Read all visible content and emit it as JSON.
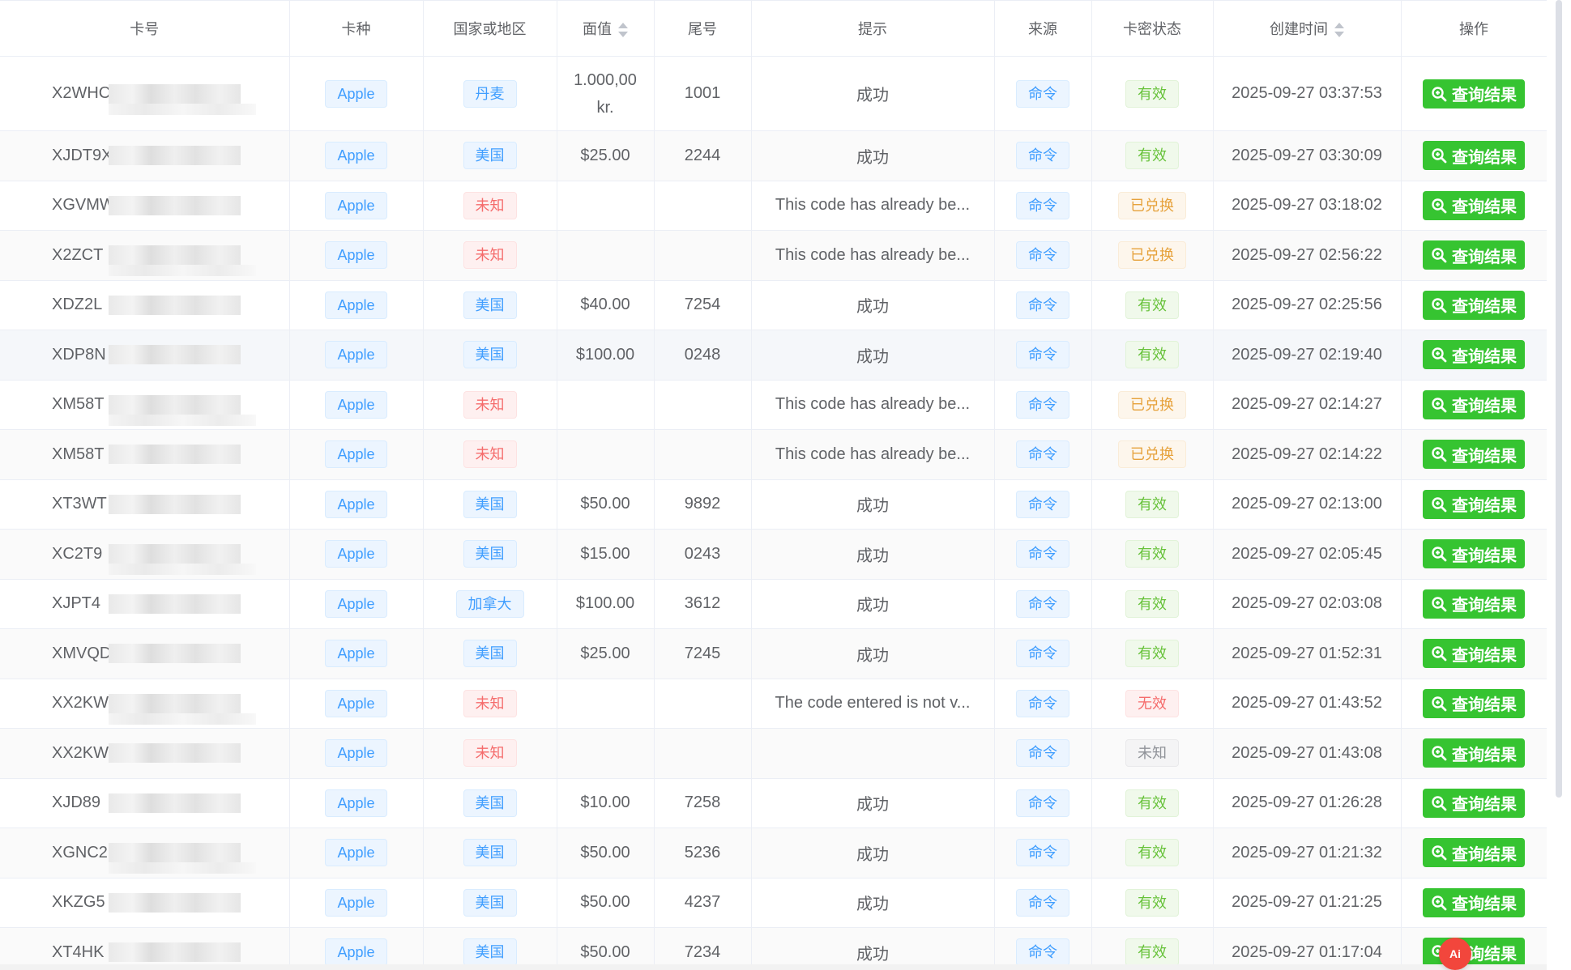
{
  "headers": {
    "card_no": "卡号",
    "card_type": "卡种",
    "country": "国家或地区",
    "value": "面值",
    "tail": "尾号",
    "hint": "提示",
    "source": "来源",
    "status": "卡密状态",
    "created": "创建时间",
    "action": "操作"
  },
  "action_label": "查询结果",
  "colors": {
    "action_button": "#36c431",
    "tag_blue": "#409eff",
    "tag_red": "#f56c6c",
    "tag_green": "#67c23a",
    "tag_orange": "#e6a23c",
    "tag_gray": "#909399"
  },
  "icons": {
    "action": "search-zoom-icon",
    "sort": "sort-caret-icon",
    "ai": "ai-assistant-icon"
  },
  "ai_badge": "Ai",
  "rows": [
    {
      "card": "X2WHC",
      "type": "Apple",
      "country": "丹麦",
      "country_color": "blue",
      "value_lines": [
        "1.000,00",
        "kr."
      ],
      "tail": "1001",
      "hint": "成功",
      "source": "命令",
      "status": "有效",
      "status_color": "green",
      "created": "2025-09-27 03:37:53"
    },
    {
      "card": "XJDT9X",
      "type": "Apple",
      "country": "美国",
      "country_color": "blue",
      "value": "$25.00",
      "tail": "2244",
      "hint": "成功",
      "source": "命令",
      "status": "有效",
      "status_color": "green",
      "created": "2025-09-27 03:30:09"
    },
    {
      "card": "XGVMW",
      "type": "Apple",
      "country": "未知",
      "country_color": "red",
      "value": "",
      "tail": "",
      "hint": "This code has already be...",
      "source": "命令",
      "status": "已兑换",
      "status_color": "orange",
      "created": "2025-09-27 03:18:02"
    },
    {
      "card": "X2ZCT",
      "type": "Apple",
      "country": "未知",
      "country_color": "red",
      "value": "",
      "tail": "",
      "hint": "This code has already be...",
      "source": "命令",
      "status": "已兑换",
      "status_color": "orange",
      "created": "2025-09-27 02:56:22"
    },
    {
      "card": "XDZ2L",
      "type": "Apple",
      "country": "美国",
      "country_color": "blue",
      "value": "$40.00",
      "tail": "7254",
      "hint": "成功",
      "source": "命令",
      "status": "有效",
      "status_color": "green",
      "created": "2025-09-27 02:25:56"
    },
    {
      "card": "XDP8N",
      "type": "Apple",
      "country": "美国",
      "country_color": "blue",
      "value": "$100.00",
      "tail": "0248",
      "hint": "成功",
      "source": "命令",
      "status": "有效",
      "status_color": "green",
      "created": "2025-09-27 02:19:40"
    },
    {
      "card": "XM58T",
      "type": "Apple",
      "country": "未知",
      "country_color": "red",
      "value": "",
      "tail": "",
      "hint": "This code has already be...",
      "source": "命令",
      "status": "已兑换",
      "status_color": "orange",
      "created": "2025-09-27 02:14:27"
    },
    {
      "card": "XM58T",
      "type": "Apple",
      "country": "未知",
      "country_color": "red",
      "value": "",
      "tail": "",
      "hint": "This code has already be...",
      "source": "命令",
      "status": "已兑换",
      "status_color": "orange",
      "created": "2025-09-27 02:14:22"
    },
    {
      "card": "XT3WT",
      "type": "Apple",
      "country": "美国",
      "country_color": "blue",
      "value": "$50.00",
      "tail": "9892",
      "hint": "成功",
      "source": "命令",
      "status": "有效",
      "status_color": "green",
      "created": "2025-09-27 02:13:00"
    },
    {
      "card": "XC2T9",
      "type": "Apple",
      "country": "美国",
      "country_color": "blue",
      "value": "$15.00",
      "tail": "0243",
      "hint": "成功",
      "source": "命令",
      "status": "有效",
      "status_color": "green",
      "created": "2025-09-27 02:05:45"
    },
    {
      "card": "XJPT4",
      "type": "Apple",
      "country": "加拿大",
      "country_color": "blue",
      "value": "$100.00",
      "tail": "3612",
      "hint": "成功",
      "source": "命令",
      "status": "有效",
      "status_color": "green",
      "created": "2025-09-27 02:03:08"
    },
    {
      "card": "XMVQD",
      "type": "Apple",
      "country": "美国",
      "country_color": "blue",
      "value": "$25.00",
      "tail": "7245",
      "hint": "成功",
      "source": "命令",
      "status": "有效",
      "status_color": "green",
      "created": "2025-09-27 01:52:31"
    },
    {
      "card": "XX2KW",
      "type": "Apple",
      "country": "未知",
      "country_color": "red",
      "value": "",
      "tail": "",
      "hint": "The code entered is not v...",
      "source": "命令",
      "status": "无效",
      "status_color": "red",
      "created": "2025-09-27 01:43:52"
    },
    {
      "card": "XX2KW",
      "type": "Apple",
      "country": "未知",
      "country_color": "red",
      "value": "",
      "tail": "",
      "hint": "",
      "source": "命令",
      "status": "未知",
      "status_color": "gray",
      "created": "2025-09-27 01:43:08"
    },
    {
      "card": "XJD89",
      "type": "Apple",
      "country": "美国",
      "country_color": "blue",
      "value": "$10.00",
      "tail": "7258",
      "hint": "成功",
      "source": "命令",
      "status": "有效",
      "status_color": "green",
      "created": "2025-09-27 01:26:28"
    },
    {
      "card": "XGNC2",
      "type": "Apple",
      "country": "美国",
      "country_color": "blue",
      "value": "$50.00",
      "tail": "5236",
      "hint": "成功",
      "source": "命令",
      "status": "有效",
      "status_color": "green",
      "created": "2025-09-27 01:21:32"
    },
    {
      "card": "XKZG5",
      "type": "Apple",
      "country": "美国",
      "country_color": "blue",
      "value": "$50.00",
      "tail": "4237",
      "hint": "成功",
      "source": "命令",
      "status": "有效",
      "status_color": "green",
      "created": "2025-09-27 01:21:25"
    },
    {
      "card": "XT4HK",
      "type": "Apple",
      "country": "美国",
      "country_color": "blue",
      "value": "$50.00",
      "tail": "7234",
      "hint": "成功",
      "source": "命令",
      "status": "有效",
      "status_color": "green",
      "created": "2025-09-27 01:17:04"
    }
  ]
}
